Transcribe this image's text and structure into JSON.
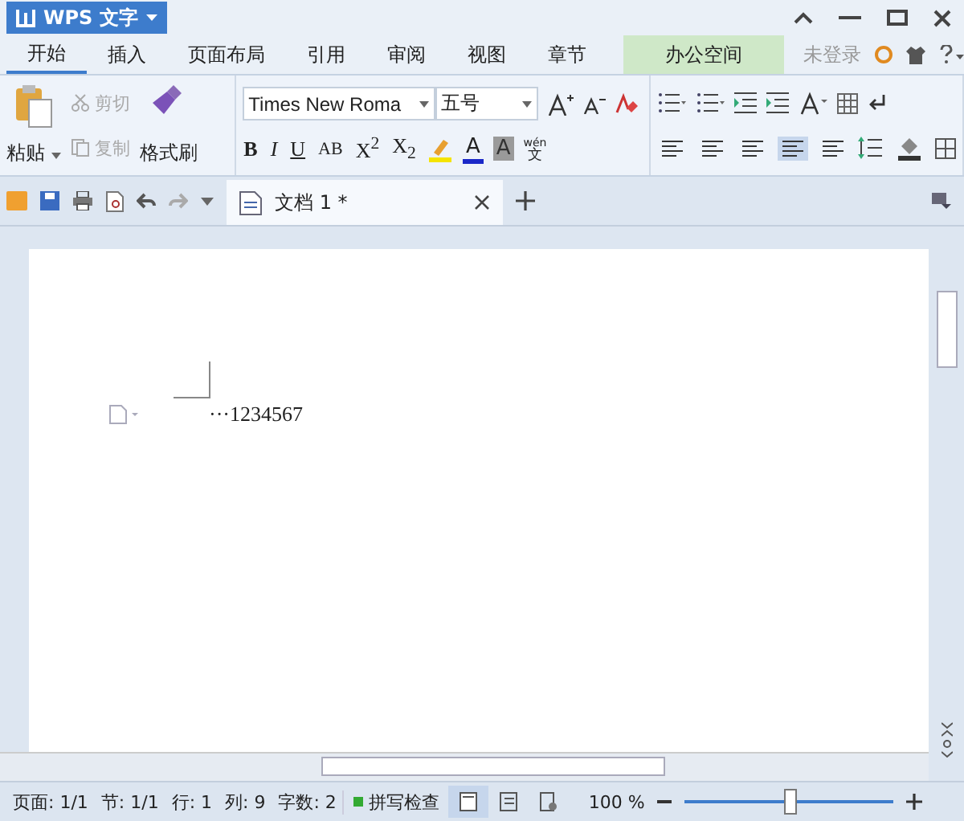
{
  "app_button": {
    "label": "WPS 文字"
  },
  "menu_tabs": [
    {
      "label": "开始",
      "selected": true,
      "kind": "tab"
    },
    {
      "label": "插入",
      "selected": false,
      "kind": "tab"
    },
    {
      "label": "页面布局",
      "selected": false,
      "kind": "tab"
    },
    {
      "label": "引用",
      "selected": false,
      "kind": "tab"
    },
    {
      "label": "审阅",
      "selected": false,
      "kind": "tab"
    },
    {
      "label": "视图",
      "selected": false,
      "kind": "tab"
    },
    {
      "label": "章节",
      "selected": false,
      "kind": "tab"
    },
    {
      "label": "办公空间",
      "selected": false,
      "kind": "special"
    }
  ],
  "account": {
    "label": "未登录"
  },
  "clipboard": {
    "paste": "粘贴",
    "cut": {
      "label": "剪切",
      "disabled": true
    },
    "copy": {
      "label": "复制",
      "disabled": true
    },
    "format_painter": "格式刷"
  },
  "font": {
    "name": "Times New Roma",
    "size": "五号"
  },
  "format_buttons": [
    {
      "label": "B",
      "kind": "bold"
    },
    {
      "label": "I",
      "kind": "italic"
    },
    {
      "label": "U",
      "kind": "underline"
    },
    {
      "label": "AB",
      "kind": "strike"
    },
    {
      "label": "X$^{2}$",
      "kind": "plain"
    },
    {
      "label": "X$_{2}$",
      "kind": "plain"
    }
  ],
  "color_buttons": [
    {
      "label": "A",
      "kind": "fontcolor",
      "color": "#1a28c8"
    },
    {
      "label": "A",
      "kind": "shade",
      "color": "#9a9a9a"
    }
  ],
  "phonetic": {
    "top": "wén",
    "bottom": "文"
  },
  "alignment": [
    {
      "selected": false
    },
    {
      "selected": false
    },
    {
      "selected": false
    },
    {
      "selected": true
    },
    {
      "selected": false
    }
  ],
  "doc_tab": {
    "title": "文档 1 *"
  },
  "document": {
    "text": "···1234567"
  },
  "status_bar": {
    "items": [
      "页面: 1/1",
      "节: 1/1",
      "行: 1",
      "列: 9",
      "字数: 2"
    ],
    "spell_check": "拼写检查",
    "zoom": "100 %",
    "zoom_level": {
      "level": 0.5
    }
  }
}
